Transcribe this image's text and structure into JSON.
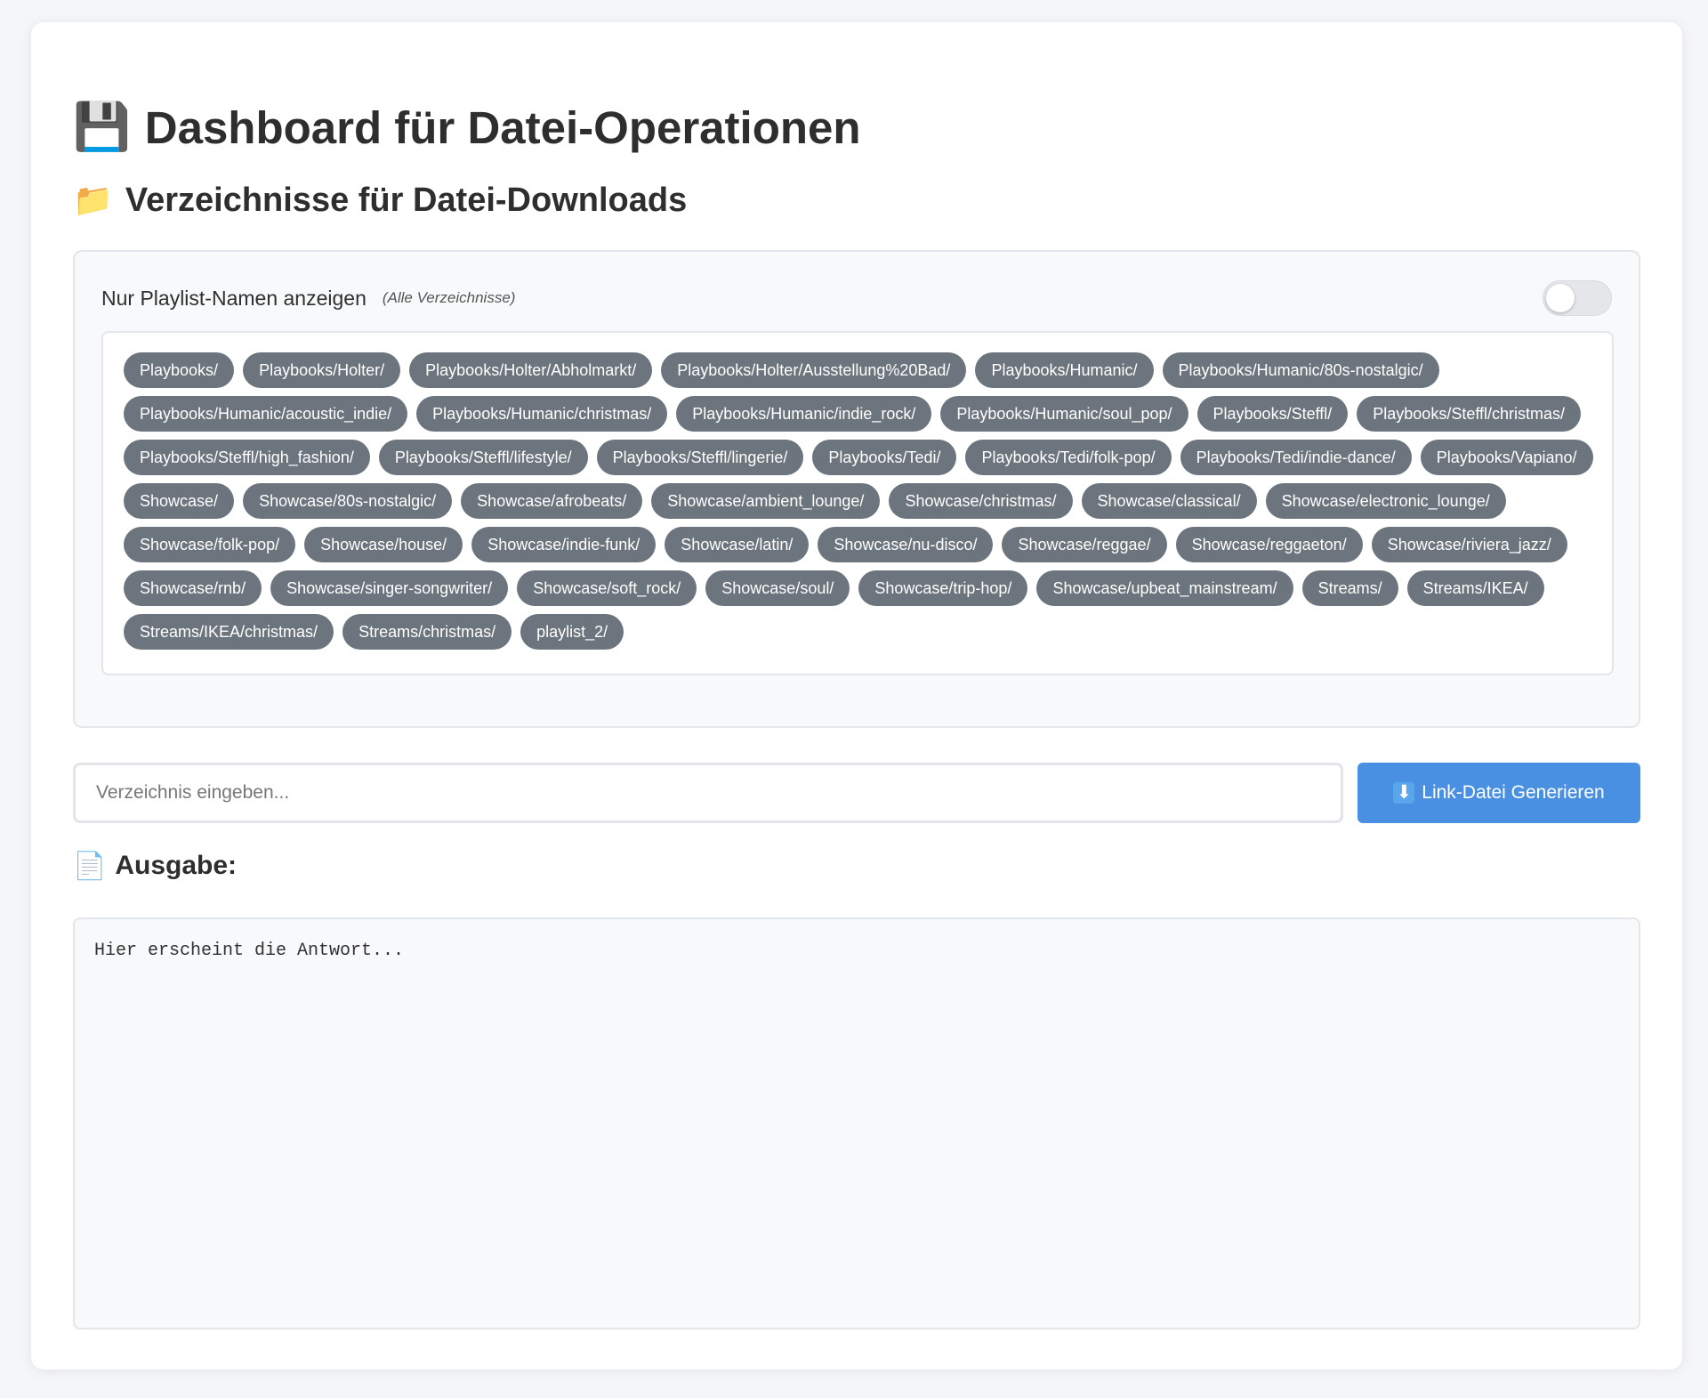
{
  "header": {
    "title_icon": "💾",
    "title": "Dashboard für Datei-Operationen",
    "subtitle_icon": "📁",
    "subtitle": "Verzeichnisse für Datei-Downloads"
  },
  "filter": {
    "label": "Nur Playlist-Namen anzeigen",
    "hint": "(Alle Verzeichnisse)",
    "toggle_on": false
  },
  "directories": [
    "Playbooks/",
    "Playbooks/Holter/",
    "Playbooks/Holter/Abholmarkt/",
    "Playbooks/Holter/Ausstellung%20Bad/",
    "Playbooks/Humanic/",
    "Playbooks/Humanic/80s-nostalgic/",
    "Playbooks/Humanic/acoustic_indie/",
    "Playbooks/Humanic/christmas/",
    "Playbooks/Humanic/indie_rock/",
    "Playbooks/Humanic/soul_pop/",
    "Playbooks/Steffl/",
    "Playbooks/Steffl/christmas/",
    "Playbooks/Steffl/high_fashion/",
    "Playbooks/Steffl/lifestyle/",
    "Playbooks/Steffl/lingerie/",
    "Playbooks/Tedi/",
    "Playbooks/Tedi/folk-pop/",
    "Playbooks/Tedi/indie-dance/",
    "Playbooks/Vapiano/",
    "Showcase/",
    "Showcase/80s-nostalgic/",
    "Showcase/afrobeats/",
    "Showcase/ambient_lounge/",
    "Showcase/christmas/",
    "Showcase/classical/",
    "Showcase/electronic_lounge/",
    "Showcase/folk-pop/",
    "Showcase/house/",
    "Showcase/indie-funk/",
    "Showcase/latin/",
    "Showcase/nu-disco/",
    "Showcase/reggae/",
    "Showcase/reggaeton/",
    "Showcase/riviera_jazz/",
    "Showcase/rnb/",
    "Showcase/singer-songwriter/",
    "Showcase/soft_rock/",
    "Showcase/soul/",
    "Showcase/trip-hop/",
    "Showcase/upbeat_mainstream/",
    "Streams/",
    "Streams/IKEA/",
    "Streams/IKEA/christmas/",
    "Streams/christmas/",
    "playlist_2/"
  ],
  "input": {
    "value": "",
    "placeholder": "Verzeichnis eingeben..."
  },
  "generate_button": {
    "icon": "⬇",
    "label": "Link-Datei Generieren"
  },
  "output": {
    "heading_icon": "📄",
    "heading": "Ausgabe:",
    "text": "Hier erscheint die Antwort..."
  },
  "colors": {
    "tag_bg": "#6c757d",
    "accent": "#4a90e2"
  }
}
